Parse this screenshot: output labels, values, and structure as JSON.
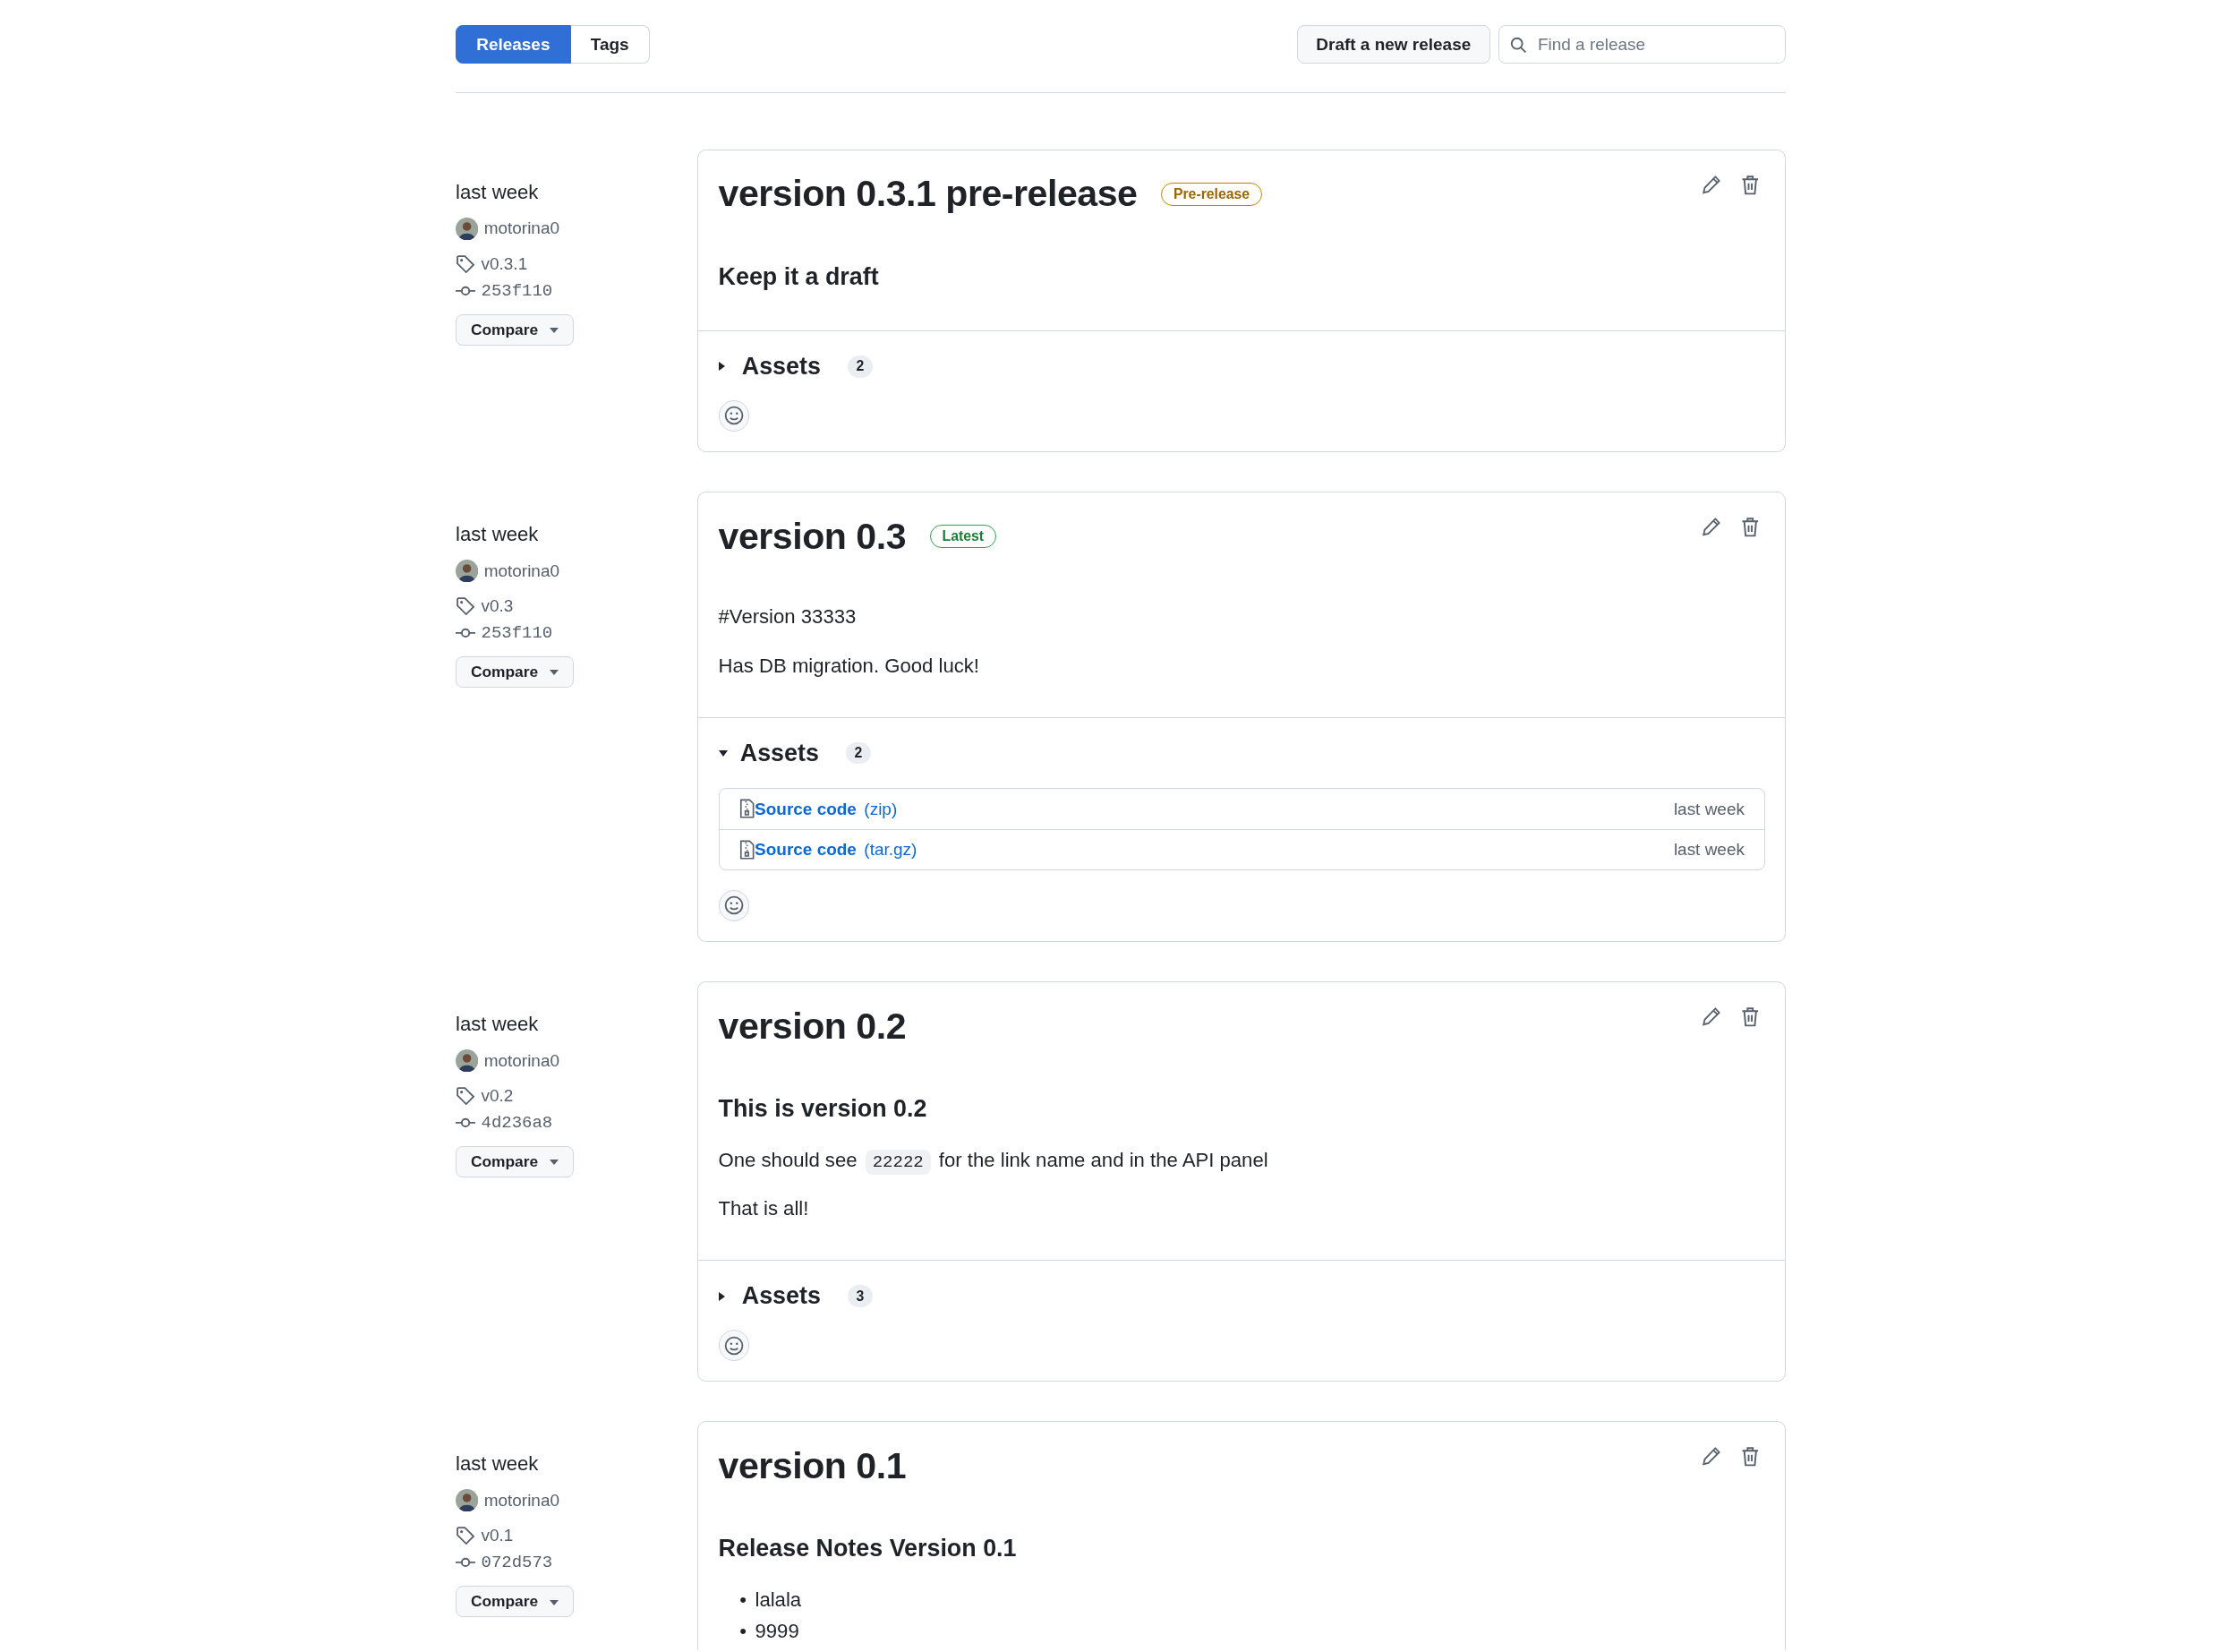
{
  "tabs": [
    {
      "label": "Releases",
      "selected": true
    },
    {
      "label": "Tags",
      "selected": false
    }
  ],
  "draft_button": "Draft a new release",
  "search": {
    "placeholder": "Find a release"
  },
  "releases": [
    {
      "time": "last week",
      "author": "motorina0",
      "tag": "v0.3.1",
      "commit": "253f110",
      "compare": "Compare",
      "title": "version 0.3.1 pre-release",
      "badge": {
        "kind": "prerelease",
        "text": "Pre-release"
      },
      "body": [
        {
          "kind": "heading",
          "text": "Keep it a draft"
        }
      ],
      "assets": {
        "label": "Assets",
        "count": "2",
        "expanded": false
      }
    },
    {
      "time": "last week",
      "author": "motorina0",
      "tag": "v0.3",
      "commit": "253f110",
      "compare": "Compare",
      "title": "version 0.3",
      "badge": {
        "kind": "latest",
        "text": "Latest"
      },
      "body": [
        {
          "kind": "paragraph",
          "text": "#Version 33333"
        },
        {
          "kind": "paragraph",
          "text": "Has DB migration. Good luck!"
        }
      ],
      "assets": {
        "label": "Assets",
        "count": "2",
        "expanded": true,
        "items": [
          {
            "name": "Source code",
            "ext": "(zip)",
            "time": "last week"
          },
          {
            "name": "Source code",
            "ext": "(tar.gz)",
            "time": "last week"
          }
        ]
      }
    },
    {
      "time": "last week",
      "author": "motorina0",
      "tag": "v0.2",
      "commit": "4d236a8",
      "compare": "Compare",
      "title": "version 0.2",
      "body": [
        {
          "kind": "heading",
          "text": "This is version 0.2"
        },
        {
          "kind": "code_paragraph",
          "before": "One should see",
          "code": "22222",
          "after": "for the link name and in the API panel"
        },
        {
          "kind": "paragraph",
          "text": "That is all!"
        }
      ],
      "assets": {
        "label": "Assets",
        "count": "3",
        "expanded": false
      }
    },
    {
      "time": "last week",
      "author": "motorina0",
      "tag": "v0.1",
      "commit": "072d573",
      "compare": "Compare",
      "title": "version 0.1",
      "body": [
        {
          "kind": "heading",
          "text": "Release Notes Version 0.1"
        },
        {
          "kind": "list",
          "marker": "•",
          "items": [
            "lalala",
            "9999"
          ]
        }
      ]
    }
  ]
}
